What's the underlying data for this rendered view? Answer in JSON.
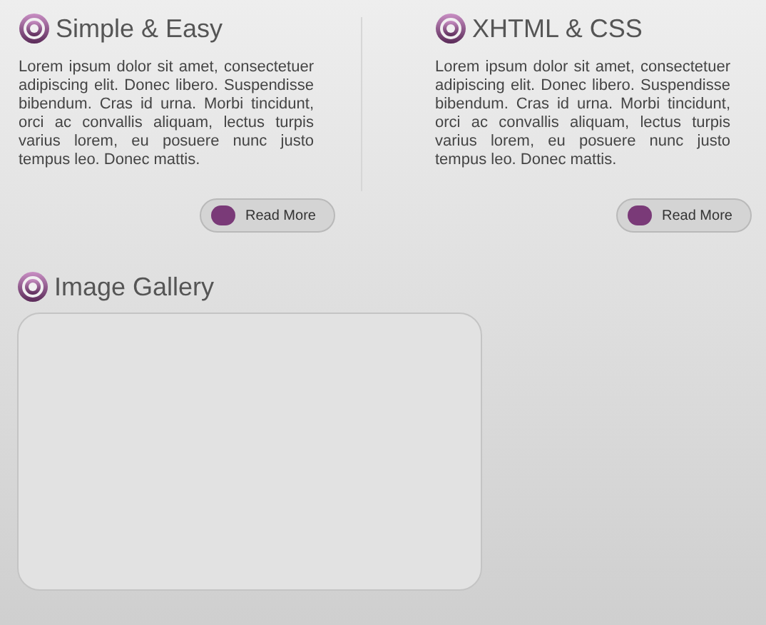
{
  "features": [
    {
      "title": "Simple & Easy",
      "body": "Lorem ipsum dolor sit amet, consectetuer adipiscing elit. Donec libero. Suspendisse bibendum. Cras id urna. Morbi tincidunt, orci ac convallis aliquam, lectus turpis varius lorem, eu posuere nunc justo tempus leo. Donec mattis.",
      "button": "Read More"
    },
    {
      "title": "XHTML & CSS",
      "body": "Lorem ipsum dolor sit amet, consectetuer adipiscing elit. Donec libero. Suspendisse bibendum. Cras id urna. Morbi tincidunt, orci ac convallis aliquam, lectus turpis varius lorem, eu posuere nunc justo tempus leo. Donec mattis.",
      "button": "Read More"
    }
  ],
  "gallery": {
    "title": "Image Gallery"
  }
}
